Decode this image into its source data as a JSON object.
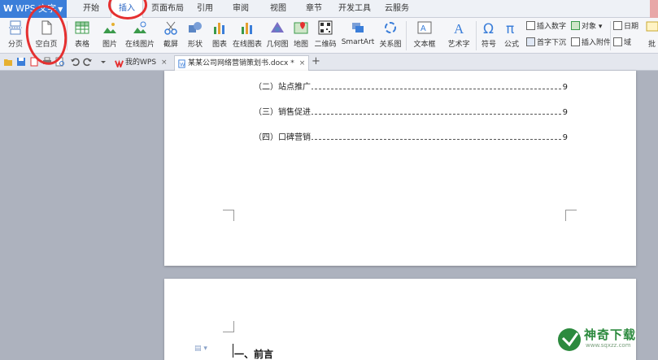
{
  "app": {
    "name": "WPS 文字",
    "logo_letter": "W"
  },
  "menu_tabs": [
    "开始",
    "插入",
    "页面布局",
    "引用",
    "审阅",
    "视图",
    "章节",
    "开发工具",
    "云服务"
  ],
  "active_tab": "插入",
  "ribbon": {
    "page_break": "分页",
    "blank_page": "空白页",
    "table": "表格",
    "picture": "图片",
    "online_picture": "在线图片",
    "screenshot": "截屏",
    "shape": "形状",
    "chart": "图表",
    "online_chart": "在线图表",
    "geometry": "几何图",
    "map": "地图",
    "qrcode": "二维码",
    "smartart": "SmartArt",
    "relation": "关系图",
    "textbox": "文本框",
    "wordart": "艺术字",
    "symbol": "符号",
    "formula": "公式",
    "insert_number": "插入数字",
    "drop_cap": "首字下沉",
    "object": "对象",
    "attachment": "插入附件",
    "date": "日期",
    "field": "域",
    "comment_short": "批"
  },
  "doc_tabs": [
    {
      "label": "我的WPS"
    },
    {
      "label": "某某公司网络营销策划书.docx *"
    }
  ],
  "toc": [
    {
      "text": "（二）站点推广",
      "page": "9"
    },
    {
      "text": "（三）销售促进",
      "page": "9"
    },
    {
      "text": "（四）口碑营销",
      "page": "9"
    }
  ],
  "heading": "一、前言",
  "watermark": {
    "name": "神奇下载",
    "url": "www.sqxzz.com"
  },
  "colors": {
    "app_blue": "#3b7ed9",
    "annotation_red": "#e53030",
    "watermark_green": "#2c8a3e"
  }
}
